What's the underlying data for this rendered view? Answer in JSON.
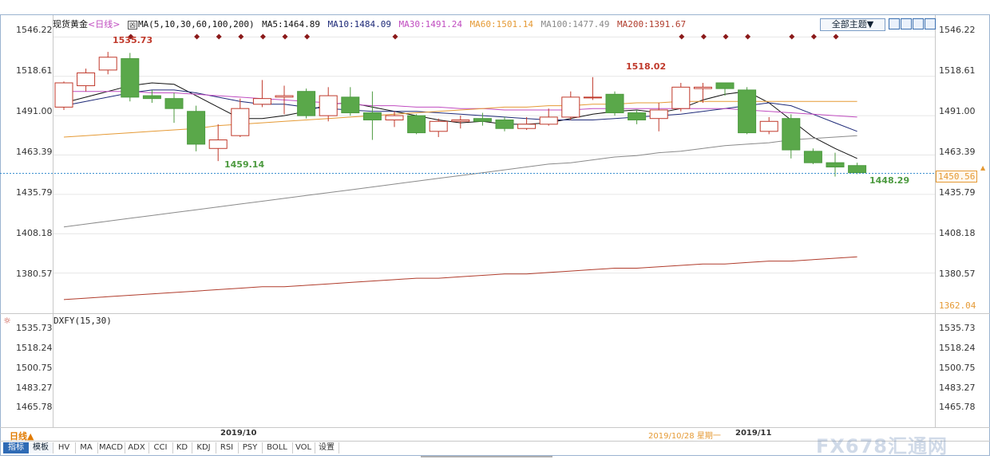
{
  "header": {
    "symbol": "现货黄金",
    "period_tag": "<日线>",
    "ma_label": "MA(5,10,30,60,100,200)",
    "ma5": "MA5:1464.89",
    "ma10": "MA10:1484.09",
    "ma30": "MA30:1491.24",
    "ma60": "MA60:1501.14",
    "ma100": "MA100:1477.49",
    "ma200": "MA200:1391.67",
    "theme_button": "全部主题▼"
  },
  "colors": {
    "ma5": "#111111",
    "ma10": "#1e2a78",
    "ma30": "#c04cc0",
    "ma60": "#e59a35",
    "ma100": "#8a8a8a",
    "ma200": "#b03c2c",
    "up": "#c0392b",
    "down": "#4c9a3f",
    "down_fill": "#5aa84a",
    "marker": "#8b1a1a",
    "grid": "#e6e6e6"
  },
  "main_axis": {
    "ticks": [
      "1546.22",
      "1518.61",
      "1491.00",
      "1463.39",
      "1435.79",
      "1408.18",
      "1380.57"
    ],
    "current_price": "1450.56",
    "low_label": "1362.04"
  },
  "annotations": {
    "high": "1535.73",
    "low1": "1459.14",
    "peak2": "1518.02",
    "low2": "1448.29"
  },
  "sub_panel": {
    "title": "DXFY(15,30)",
    "ticks": [
      "1535.73",
      "1518.24",
      "1500.75",
      "1483.27",
      "1465.78"
    ]
  },
  "x_axis": {
    "period_button": "日线▲",
    "label_oct": "2019/10",
    "label_nov": "2019/11",
    "date_info": "2019/10/28 星期一"
  },
  "bottom_tabs": [
    "指标",
    "模板",
    "HV",
    "MA",
    "MACD",
    "ADX",
    "CCI",
    "KD",
    "KDJ",
    "RSI",
    "PSY",
    "BOLL",
    "VOL",
    "设置"
  ],
  "watermark": "FX678汇通网",
  "chart_data": {
    "type": "candlestick",
    "title": "现货黄金",
    "xlabel": "",
    "ylabel": "",
    "ylim": [
      1353,
      1552
    ],
    "x_ticks": [
      "2019/10",
      "2019/11"
    ],
    "candles": [
      {
        "o": 1497,
        "c": 1514,
        "h": 1515,
        "l": 1495
      },
      {
        "o": 1512,
        "c": 1521,
        "h": 1524,
        "l": 1508
      },
      {
        "o": 1523,
        "c": 1532,
        "h": 1535.73,
        "l": 1520
      },
      {
        "o": 1531,
        "c": 1504,
        "h": 1535,
        "l": 1501
      },
      {
        "o": 1505,
        "c": 1503,
        "h": 1509,
        "l": 1500
      },
      {
        "o": 1503,
        "c": 1496,
        "h": 1507,
        "l": 1486
      },
      {
        "o": 1494,
        "c": 1471,
        "h": 1498,
        "l": 1466
      },
      {
        "o": 1468,
        "c": 1474,
        "h": 1485,
        "l": 1459.14
      },
      {
        "o": 1477,
        "c": 1496,
        "h": 1503,
        "l": 1476
      },
      {
        "o": 1499,
        "c": 1503,
        "h": 1516,
        "l": 1497
      },
      {
        "o": 1504,
        "c": 1505,
        "h": 1512,
        "l": 1492
      },
      {
        "o": 1508,
        "c": 1491,
        "h": 1510,
        "l": 1489
      },
      {
        "o": 1491,
        "c": 1505,
        "h": 1511,
        "l": 1487
      },
      {
        "o": 1504,
        "c": 1493,
        "h": 1511,
        "l": 1491
      },
      {
        "o": 1493,
        "c": 1488,
        "h": 1508,
        "l": 1474
      },
      {
        "o": 1488,
        "c": 1491,
        "h": 1494,
        "l": 1483
      },
      {
        "o": 1491,
        "c": 1479,
        "h": 1492,
        "l": 1478
      },
      {
        "o": 1480,
        "c": 1487,
        "h": 1489,
        "l": 1476
      },
      {
        "o": 1487,
        "c": 1488,
        "h": 1491,
        "l": 1482
      },
      {
        "o": 1489,
        "c": 1487,
        "h": 1493,
        "l": 1484
      },
      {
        "o": 1488,
        "c": 1482,
        "h": 1490,
        "l": 1480
      },
      {
        "o": 1482,
        "c": 1485,
        "h": 1490,
        "l": 1481
      },
      {
        "o": 1485,
        "c": 1490,
        "h": 1496,
        "l": 1484
      },
      {
        "o": 1490,
        "c": 1504,
        "h": 1508,
        "l": 1488
      },
      {
        "o": 1504,
        "c": 1504,
        "h": 1518.02,
        "l": 1502
      },
      {
        "o": 1506,
        "c": 1493,
        "h": 1508,
        "l": 1491
      },
      {
        "o": 1493,
        "c": 1488,
        "h": 1495,
        "l": 1485
      },
      {
        "o": 1489,
        "c": 1495,
        "h": 1500,
        "l": 1480
      },
      {
        "o": 1496,
        "c": 1511,
        "h": 1514,
        "l": 1494
      },
      {
        "o": 1510,
        "c": 1511,
        "h": 1514,
        "l": 1500
      },
      {
        "o": 1514,
        "c": 1510,
        "h": 1514,
        "l": 1505
      },
      {
        "o": 1509,
        "c": 1479,
        "h": 1511,
        "l": 1478
      },
      {
        "o": 1480,
        "c": 1487,
        "h": 1490,
        "l": 1478
      },
      {
        "o": 1489,
        "c": 1467,
        "h": 1492,
        "l": 1461
      },
      {
        "o": 1466,
        "c": 1458,
        "h": 1468,
        "l": 1457
      },
      {
        "o": 1458,
        "c": 1455,
        "h": 1465,
        "l": 1448.29
      },
      {
        "o": 1456,
        "c": 1451,
        "h": 1458,
        "l": 1450
      }
    ],
    "markers_at": [
      3,
      6,
      7,
      8,
      9,
      10,
      11,
      15,
      28,
      29,
      30,
      31,
      33,
      34,
      35
    ],
    "series": [
      {
        "name": "MA5",
        "values": [
          1500,
          1504,
          1508,
          1512,
          1514,
          1513,
          1505,
          1497,
          1489,
          1489,
          1491,
          1494,
          1499,
          1500,
          1497,
          1494,
          1491,
          1488,
          1486,
          1487,
          1485,
          1485,
          1486,
          1489,
          1492,
          1494,
          1495,
          1493,
          1496,
          1502,
          1506,
          1508,
          1500,
          1488,
          1476,
          1468,
          1461
        ]
      },
      {
        "name": "MA10",
        "values": [
          1498,
          1501,
          1504,
          1507,
          1509,
          1509,
          1507,
          1504,
          1501,
          1499,
          1499,
          1497,
          1496,
          1495,
          1494,
          1494,
          1494,
          1493,
          1492,
          1491,
          1490,
          1489,
          1488,
          1488,
          1488,
          1489,
          1490,
          1491,
          1492,
          1494,
          1496,
          1498,
          1500,
          1498,
          1492,
          1486,
          1480
        ]
      },
      {
        "name": "MA30",
        "values": [
          1508,
          1508,
          1508,
          1508,
          1507,
          1507,
          1506,
          1505,
          1504,
          1503,
          1502,
          1501,
          1500,
          1499,
          1498,
          1498,
          1497,
          1497,
          1496,
          1496,
          1495,
          1495,
          1495,
          1495,
          1496,
          1496,
          1496,
          1496,
          1496,
          1496,
          1496,
          1495,
          1494,
          1493,
          1492,
          1491,
          1490
        ]
      },
      {
        "name": "MA60",
        "values": [
          1476,
          1477,
          1478,
          1479,
          1480,
          1481,
          1482,
          1484,
          1485,
          1486,
          1487,
          1488,
          1489,
          1490,
          1491,
          1492,
          1493,
          1494,
          1495,
          1496,
          1497,
          1497,
          1498,
          1498,
          1499,
          1499,
          1500,
          1500,
          1501,
          1501,
          1501,
          1501,
          1501,
          1501,
          1501,
          1501,
          1501
        ]
      },
      {
        "name": "MA100",
        "values": [
          1413,
          1415,
          1417,
          1419,
          1421,
          1423,
          1425,
          1427,
          1429,
          1431,
          1433,
          1435,
          1437,
          1439,
          1441,
          1443,
          1445,
          1447,
          1449,
          1451,
          1453,
          1455,
          1457,
          1458,
          1460,
          1462,
          1463,
          1465,
          1466,
          1468,
          1470,
          1471,
          1472,
          1474,
          1475,
          1476,
          1477
        ]
      },
      {
        "name": "MA200",
        "values": [
          1362,
          1363,
          1364,
          1365,
          1366,
          1367,
          1368,
          1369,
          1370,
          1371,
          1371,
          1372,
          1373,
          1374,
          1375,
          1376,
          1377,
          1377,
          1378,
          1379,
          1380,
          1380,
          1381,
          1382,
          1383,
          1384,
          1384,
          1385,
          1386,
          1387,
          1387,
          1388,
          1389,
          1389,
          1390,
          1391,
          1392
        ]
      }
    ]
  }
}
